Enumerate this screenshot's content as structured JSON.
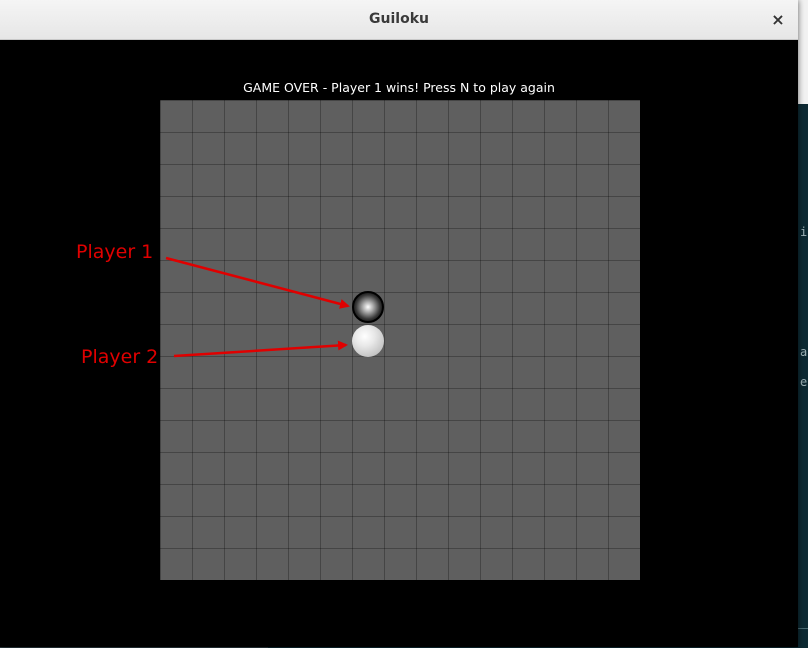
{
  "window": {
    "title": "Guiloku",
    "close_glyph": "×"
  },
  "game": {
    "status_text": "GAME OVER - Player 1 wins! Press N to play again",
    "board": {
      "cols": 15,
      "rows": 15
    },
    "stones": [
      {
        "player": 1,
        "color": "black",
        "col": 6,
        "row": 6
      },
      {
        "player": 2,
        "color": "white",
        "col": 6,
        "row": 7
      }
    ]
  },
  "annotations": {
    "player1_label": "Player 1",
    "player2_label": "Player 2",
    "color": "#e00000"
  },
  "icons": {
    "close": "close-icon"
  }
}
